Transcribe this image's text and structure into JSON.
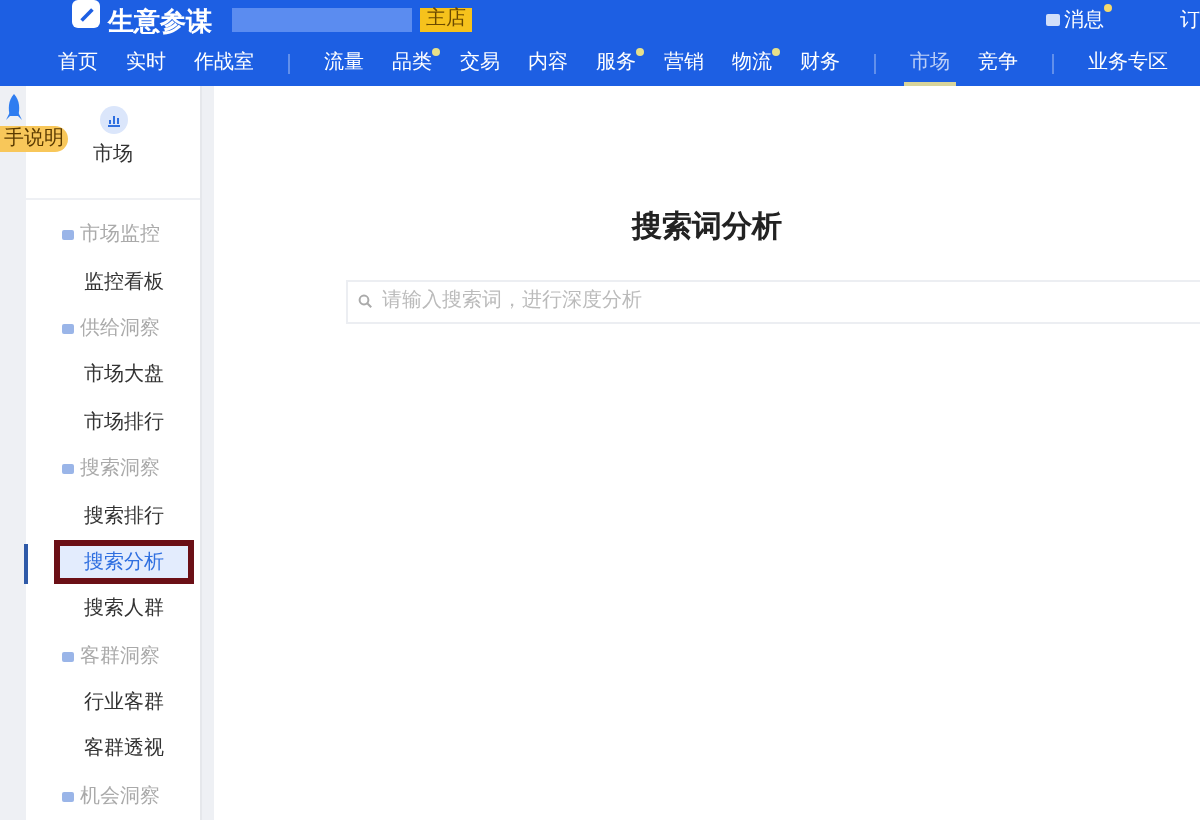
{
  "header": {
    "logo_text": "生意参谋",
    "shop_badge": "主店",
    "messages": "消息",
    "message_dot": true,
    "cut_link": "订"
  },
  "nav_groups": [
    {
      "tabs": [
        {
          "label": "首页",
          "selected": false,
          "dot": false
        },
        {
          "label": "实时",
          "selected": false,
          "dot": false
        },
        {
          "label": "作战室",
          "selected": false,
          "dot": false
        }
      ]
    },
    {
      "tabs": [
        {
          "label": "流量",
          "selected": false,
          "dot": false
        },
        {
          "label": "品类",
          "selected": false,
          "dot": true
        },
        {
          "label": "交易",
          "selected": false,
          "dot": false
        },
        {
          "label": "内容",
          "selected": false,
          "dot": false
        },
        {
          "label": "服务",
          "selected": false,
          "dot": true
        },
        {
          "label": "营销",
          "selected": false,
          "dot": false
        },
        {
          "label": "物流",
          "selected": false,
          "dot": true
        },
        {
          "label": "财务",
          "selected": false,
          "dot": false
        }
      ]
    },
    {
      "tabs": [
        {
          "label": "市场",
          "selected": true,
          "dot": false
        },
        {
          "label": "竞争",
          "selected": false,
          "dot": false
        }
      ]
    },
    {
      "tabs": [
        {
          "label": "业务专区",
          "selected": false,
          "dot": false
        }
      ]
    }
  ],
  "guide_tab": "手说明",
  "sidebar": {
    "title": "市场",
    "groups": [
      {
        "label": "市场监控",
        "items": [
          {
            "label": "监控看板",
            "selected": false,
            "highlighted": false
          }
        ]
      },
      {
        "label": "供给洞察",
        "items": [
          {
            "label": "市场大盘",
            "selected": false,
            "highlighted": false
          },
          {
            "label": "市场排行",
            "selected": false,
            "highlighted": false
          }
        ]
      },
      {
        "label": "搜索洞察",
        "items": [
          {
            "label": "搜索排行",
            "selected": false,
            "highlighted": false
          },
          {
            "label": "搜索分析",
            "selected": true,
            "highlighted": true
          },
          {
            "label": "搜索人群",
            "selected": false,
            "highlighted": false
          }
        ]
      },
      {
        "label": "客群洞察",
        "items": [
          {
            "label": "行业客群",
            "selected": false,
            "highlighted": false
          },
          {
            "label": "客群透视",
            "selected": false,
            "highlighted": false
          }
        ]
      },
      {
        "label": "机会洞察"
      }
    ]
  },
  "main": {
    "title": "搜索词分析",
    "search": {
      "placeholder": "请输入搜索词，进行深度分析"
    }
  }
}
